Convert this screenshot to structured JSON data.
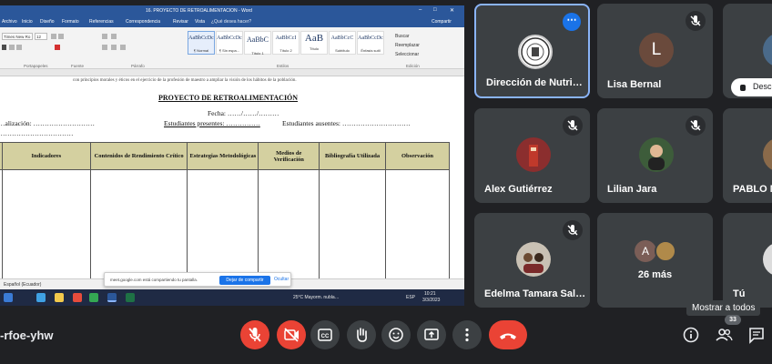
{
  "word": {
    "title": "16. PROYECTO DE RETROALIMENTACION - Word",
    "account": "Compartir",
    "menu": [
      "Archivo",
      "Inicio",
      "Diseño",
      "Formato",
      "Referencias",
      "Correspondencia",
      "Revisar",
      "Vista",
      "¿Qué desea hacer?"
    ],
    "font_name": "Times New Ro",
    "font_size": "12",
    "styles": [
      {
        "sample": "AaBbCcDc",
        "name": "¶ Normal"
      },
      {
        "sample": "AaBbCcDc",
        "name": "¶ Sin espa..."
      },
      {
        "sample": "AaBbC",
        "name": "Título 1"
      },
      {
        "sample": "AaBbCcI",
        "name": "Título 2"
      },
      {
        "sample": "AaB",
        "name": "Título"
      },
      {
        "sample": "AaBbCcC",
        "name": "Subtítulo"
      },
      {
        "sample": "AaBbCcDc",
        "name": "Énfasis sutil"
      }
    ],
    "edit_items": [
      "Buscar",
      "Reemplazar",
      "Seleccionar"
    ],
    "groups": [
      "Portapapeles",
      "Fuente",
      "Párrafo",
      "Estilos",
      "Edición"
    ],
    "prev_line": "con principios morales y éticos en el ejercicio de la profesión de maestro a ampliar la visión de los hábitos de la población.",
    "doc_title": "PROYECTO DE RETROALIMENTACIÓN",
    "fecha": "Fecha: ……/……/………",
    "realizacion": "…alización: ………………………",
    "presentes": "Estudiantes presentes: ……………",
    "ausentes": "Estudiantes ausentes: …………………………",
    "table_headers": [
      "",
      "Indicadores",
      "Contenidos de Rendimiento Crítico",
      "Estrategias Metodológicas",
      "Medios de Verificación",
      "Bibliografía Utilizada",
      "Observación"
    ],
    "status_left": "Español (Ecuador)",
    "share_notice": "meet.google.com está compartiendo tu pantalla.",
    "stop_share": "Dejar de compartir",
    "hide": "Ocultar",
    "weather": "25°C Mayorm. nubla…",
    "clock_time": "10:21",
    "clock_date": "3/3/2023",
    "lang": "ESP"
  },
  "participants": [
    {
      "name": "Dirección de Nutri…",
      "avatar": "logo",
      "muted": false,
      "active": true
    },
    {
      "name": "Lisa Bernal",
      "avatar": "L",
      "muted": true
    },
    {
      "name": "Desc…",
      "avatar": "photo",
      "muted": false
    },
    {
      "name": "Alex Gutiérrez",
      "avatar": "photo",
      "muted": true
    },
    {
      "name": "Lilian Jara",
      "avatar": "photo",
      "muted": true
    },
    {
      "name": "PABLO M…",
      "avatar": "photo",
      "muted": false
    },
    {
      "name": "Edelma Tamara Sal…",
      "avatar": "photo",
      "muted": true
    },
    {
      "name": "26 más",
      "avatar": "A",
      "muted": false
    },
    {
      "name": "Tú",
      "avatar": "photo",
      "muted": false
    }
  ],
  "meeting_code": "-rfoe-yhw",
  "controls": [
    "microphone-off",
    "camera-off",
    "captions",
    "raise-hand",
    "emoji",
    "present",
    "more-options",
    "leave-call"
  ],
  "tooltip": "Mostrar a todos",
  "participant_count": "33",
  "colors": {
    "background": "#202124",
    "tile": "#3c4043",
    "accent": "#1a73e8",
    "danger": "#ea4335",
    "word_blue": "#2b579a"
  }
}
